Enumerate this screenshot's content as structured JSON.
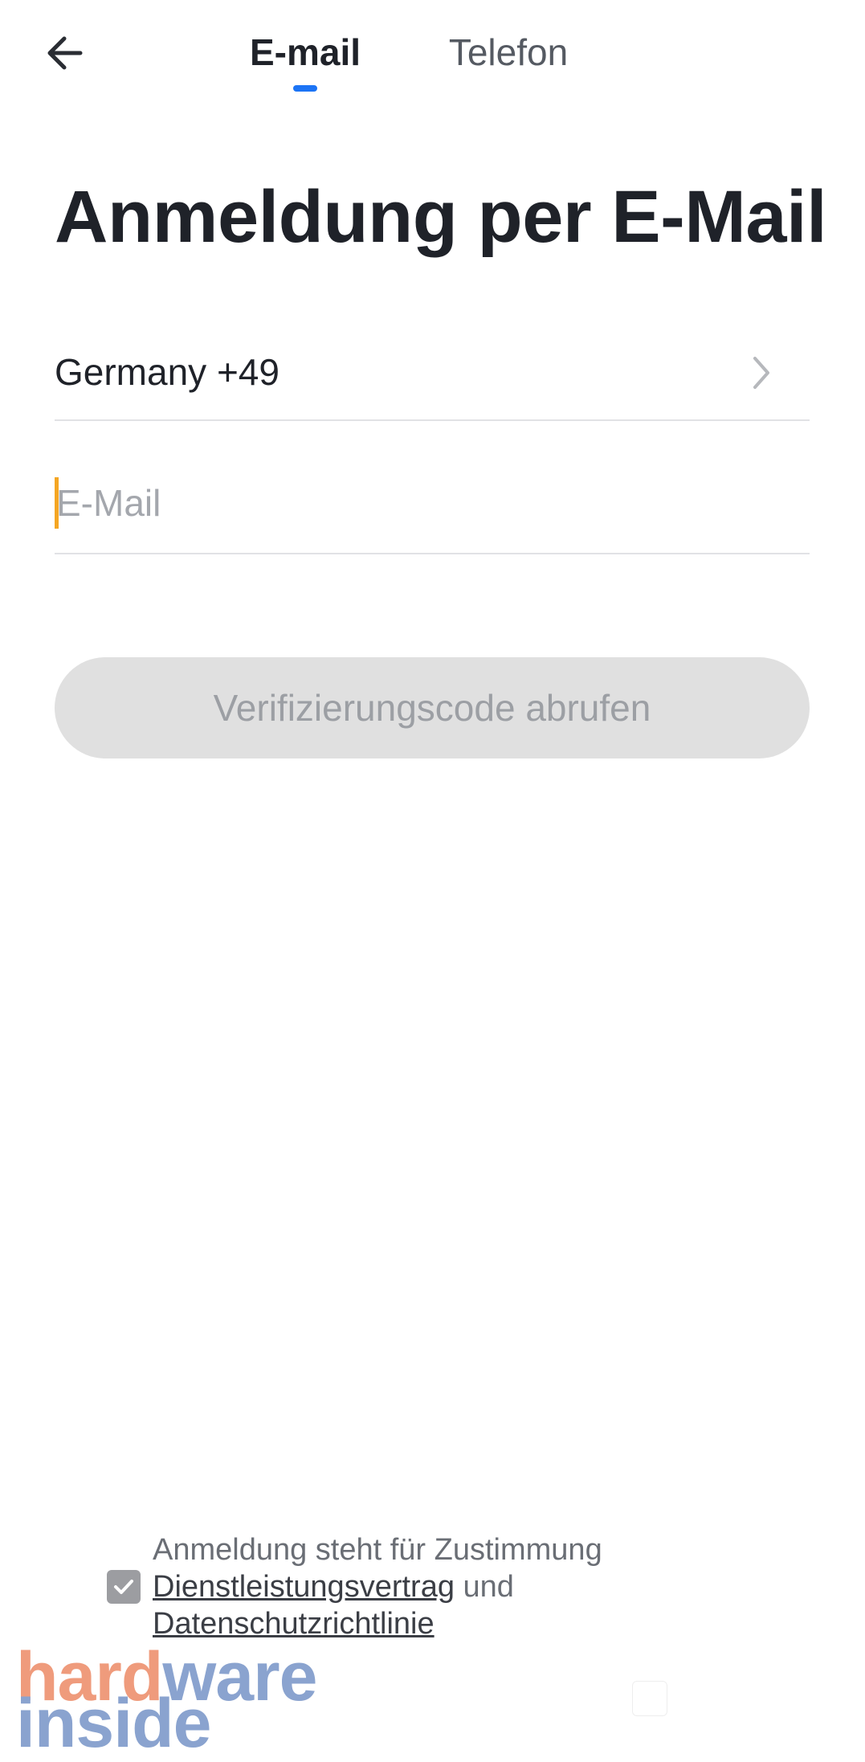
{
  "header": {
    "back_icon": "arrow-left-icon",
    "tabs": [
      {
        "label": "E-mail",
        "active": true
      },
      {
        "label": "Telefon",
        "active": false
      }
    ],
    "accent_color": "#1c74f5"
  },
  "main": {
    "title": "Anmeldung per E-Mail",
    "country": {
      "label": "Germany +49",
      "icon": "chevron-right-icon"
    },
    "email_field": {
      "value": "",
      "placeholder": "E-Mail"
    },
    "submit_label": "Verifizierungscode abrufen"
  },
  "consent": {
    "checked": true,
    "text_prefix": "Anmeldung steht für Zustimmung",
    "terms_link": "Dienstleistungsvertrag",
    "conjunction": "und",
    "privacy_link": "Datenschutzrichtlinie"
  },
  "watermark": {
    "part_a": "hard",
    "part_b": "ware",
    "line2": "inside"
  }
}
